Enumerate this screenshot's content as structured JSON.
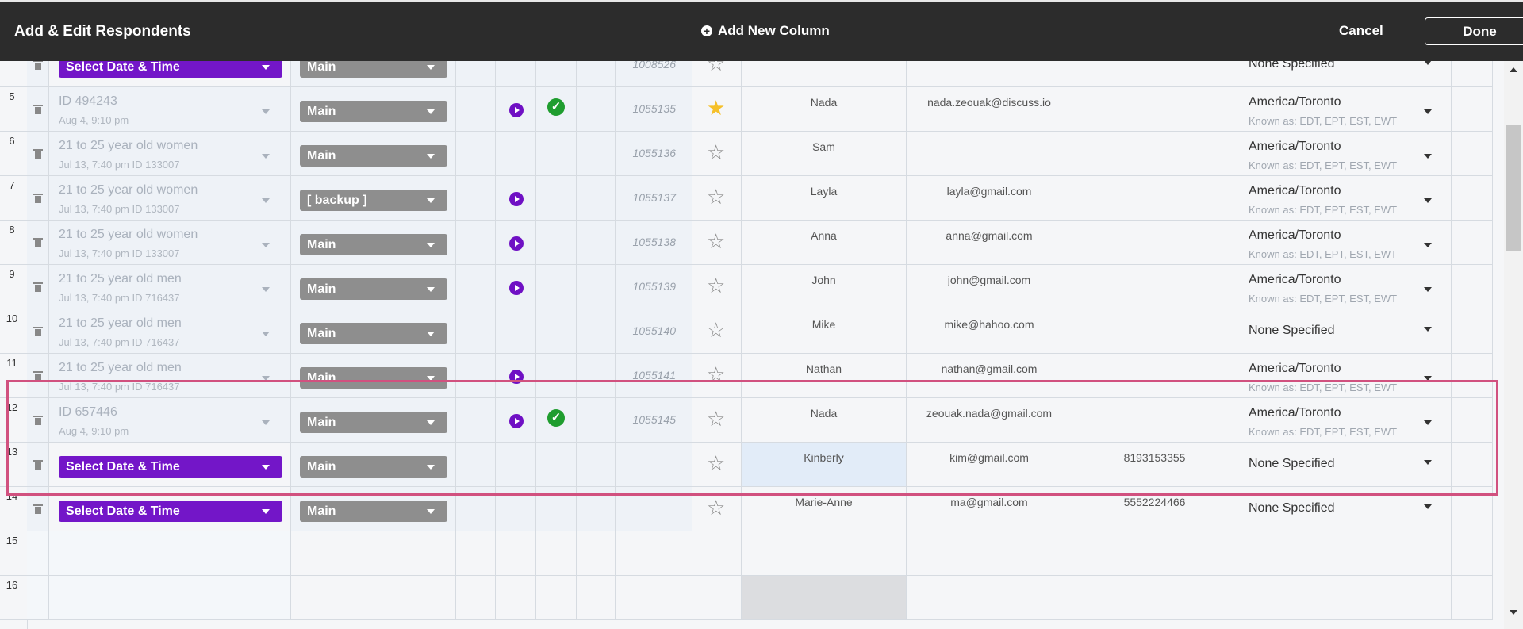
{
  "header": {
    "title": "Add & Edit Respondents",
    "add_column_label": "Add New Column",
    "cancel_label": "Cancel",
    "done_label": "Done"
  },
  "rows": [
    {
      "num": "",
      "date_button": "Select Date & Time",
      "group": "Main",
      "play": false,
      "check": false,
      "id": "1008526",
      "star": false,
      "name": "",
      "email": "",
      "phone": "",
      "tz": "None Specified",
      "tz_known": ""
    },
    {
      "num": "5",
      "segment": "ID 494243",
      "segment_sub": "Aug 4, 9:10 pm",
      "group": "Main",
      "play": true,
      "check": true,
      "id": "1055135",
      "star": true,
      "name": "Nada",
      "email": "nada.zeouak@discuss.io",
      "phone": "",
      "tz": "America/Toronto",
      "tz_known": "Known as: EDT, EPT, EST, EWT"
    },
    {
      "num": "6",
      "segment": "21 to 25 year old women",
      "segment_sub": "Jul 13, 7:40 pm     ID 133007",
      "group": "Main",
      "play": false,
      "check": false,
      "id": "1055136",
      "star": false,
      "name": "Sam",
      "email": "",
      "phone": "",
      "tz": "America/Toronto",
      "tz_known": "Known as: EDT, EPT, EST, EWT"
    },
    {
      "num": "7",
      "segment": "21 to 25 year old women",
      "segment_sub": "Jul 13, 7:40 pm     ID 133007",
      "group": "[ backup ]",
      "play": true,
      "check": false,
      "id": "1055137",
      "star": false,
      "name": "Layla",
      "email": "layla@gmail.com",
      "phone": "",
      "tz": "America/Toronto",
      "tz_known": "Known as: EDT, EPT, EST, EWT"
    },
    {
      "num": "8",
      "segment": "21 to 25 year old women",
      "segment_sub": "Jul 13, 7:40 pm     ID 133007",
      "group": "Main",
      "play": true,
      "check": false,
      "id": "1055138",
      "star": false,
      "name": "Anna",
      "email": "anna@gmail.com",
      "phone": "",
      "tz": "America/Toronto",
      "tz_known": "Known as: EDT, EPT, EST, EWT"
    },
    {
      "num": "9",
      "segment": "21 to 25 year old men",
      "segment_sub": "Jul 13, 7:40 pm   ID 716437",
      "group": "Main",
      "play": true,
      "check": false,
      "id": "1055139",
      "star": false,
      "name": "John",
      "email": "john@gmail.com",
      "phone": "",
      "tz": "America/Toronto",
      "tz_known": "Known as: EDT, EPT, EST, EWT"
    },
    {
      "num": "10",
      "segment": "21 to 25 year old men",
      "segment_sub": "Jul 13, 7:40 pm   ID 716437",
      "group": "Main",
      "play": false,
      "check": false,
      "id": "1055140",
      "star": false,
      "name": "Mike",
      "email": "mike@hahoo.com",
      "phone": "",
      "tz": "None Specified",
      "tz_known": ""
    },
    {
      "num": "11",
      "segment": "21 to 25 year old men",
      "segment_sub": "Jul 13, 7:40 pm   ID 716437",
      "group": "Main",
      "play": true,
      "check": false,
      "id": "1055141",
      "star": false,
      "name": "Nathan",
      "email": "nathan@gmail.com",
      "phone": "",
      "tz": "America/Toronto",
      "tz_known": "Known as: EDT, EPT, EST, EWT"
    },
    {
      "num": "12",
      "segment": "ID 657446",
      "segment_sub": "Aug 4, 9:10 pm",
      "group": "Main",
      "play": true,
      "check": true,
      "id": "1055145",
      "star": false,
      "name": "Nada",
      "email": "zeouak.nada@gmail.com",
      "phone": "",
      "tz": "America/Toronto",
      "tz_known": "Known as: EDT, EPT, EST, EWT"
    },
    {
      "num": "13",
      "date_button": "Select Date & Time",
      "group": "Main",
      "play": false,
      "check": false,
      "id": "",
      "star": false,
      "name": "Kinberly",
      "email": "kim@gmail.com",
      "phone": "8193153355",
      "tz": "None Specified",
      "tz_known": ""
    },
    {
      "num": "14",
      "date_button": "Select Date & Time",
      "group": "Main",
      "play": false,
      "check": false,
      "id": "",
      "star": false,
      "name": "Marie-Anne",
      "email": "ma@gmail.com",
      "phone": "5552224466",
      "tz": "None Specified",
      "tz_known": ""
    },
    {
      "num": "15",
      "empty": true
    },
    {
      "num": "16",
      "empty": true
    }
  ]
}
